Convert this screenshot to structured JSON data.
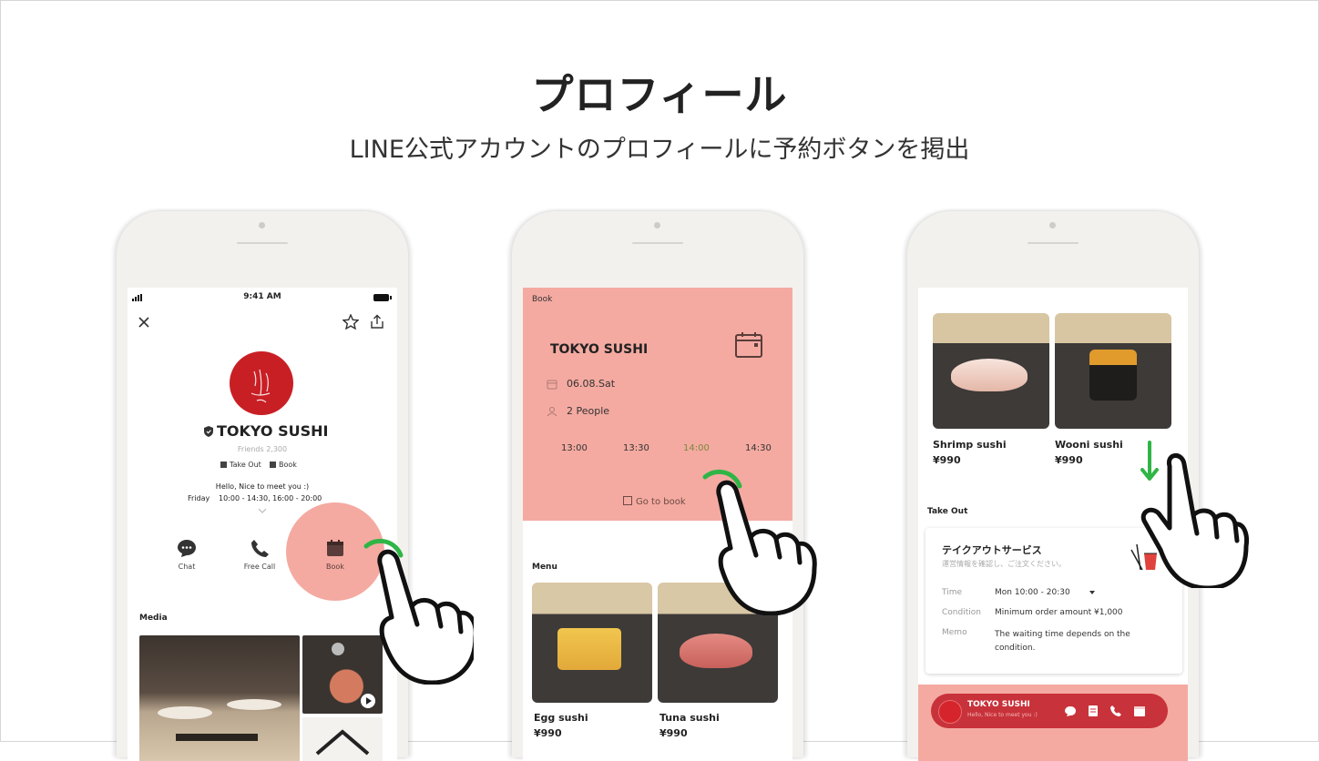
{
  "heading": {
    "title": "プロフィール",
    "subtitle": "LINE公式アカウントのプロフィールに予約ボタンを掲出"
  },
  "colors": {
    "accent": "#c81f25",
    "salmon": "#f4aaa1",
    "green": "#2fb545"
  },
  "phone1": {
    "status_time": "9:41 AM",
    "shop_name": "TOKYO SUSHI",
    "friends": "Friends 2,300",
    "tags": [
      "Take Out",
      "Book"
    ],
    "greeting": "Hello, Nice to meet you :)",
    "hours_day": "Friday",
    "hours": "10:00 - 14:30, 16:00 - 20:00",
    "actions": [
      {
        "label": "Chat",
        "icon": "chat-icon"
      },
      {
        "label": "Free Call",
        "icon": "phone-icon"
      },
      {
        "label": "Book",
        "icon": "calendar-icon"
      }
    ],
    "media_label": "Media"
  },
  "phone2": {
    "header": "Book",
    "shop_name": "TOKYO SUSHI",
    "date": "06.08.Sat",
    "people": "2 People",
    "times": [
      "13:00",
      "13:30",
      "14:00",
      "14:30"
    ],
    "selected_time": "14:00",
    "cta": "Go to book",
    "menu_label": "Menu",
    "items": [
      {
        "name": "Egg sushi",
        "price": "¥990"
      },
      {
        "name": "Tuna sushi",
        "price": "¥990"
      }
    ]
  },
  "phone3": {
    "items": [
      {
        "name": "Shrimp sushi",
        "price": "¥990"
      },
      {
        "name": "Wooni sushi",
        "price": "¥990"
      }
    ],
    "takeout_label": "Take Out",
    "card_title": "テイクアウトサービス",
    "card_sub": "運営情報を確認し、ご注文ください。",
    "rows": [
      {
        "key": "Time",
        "value": "Mon 10:00 - 20:30"
      },
      {
        "key": "Condition",
        "value": "Minimum order amount ¥1,000"
      },
      {
        "key": "Memo",
        "value": "The waiting time depends on the condition."
      }
    ],
    "bar_name": "TOKYO SUSHI",
    "bar_sub": "Hello, Nice to meet you :)"
  }
}
